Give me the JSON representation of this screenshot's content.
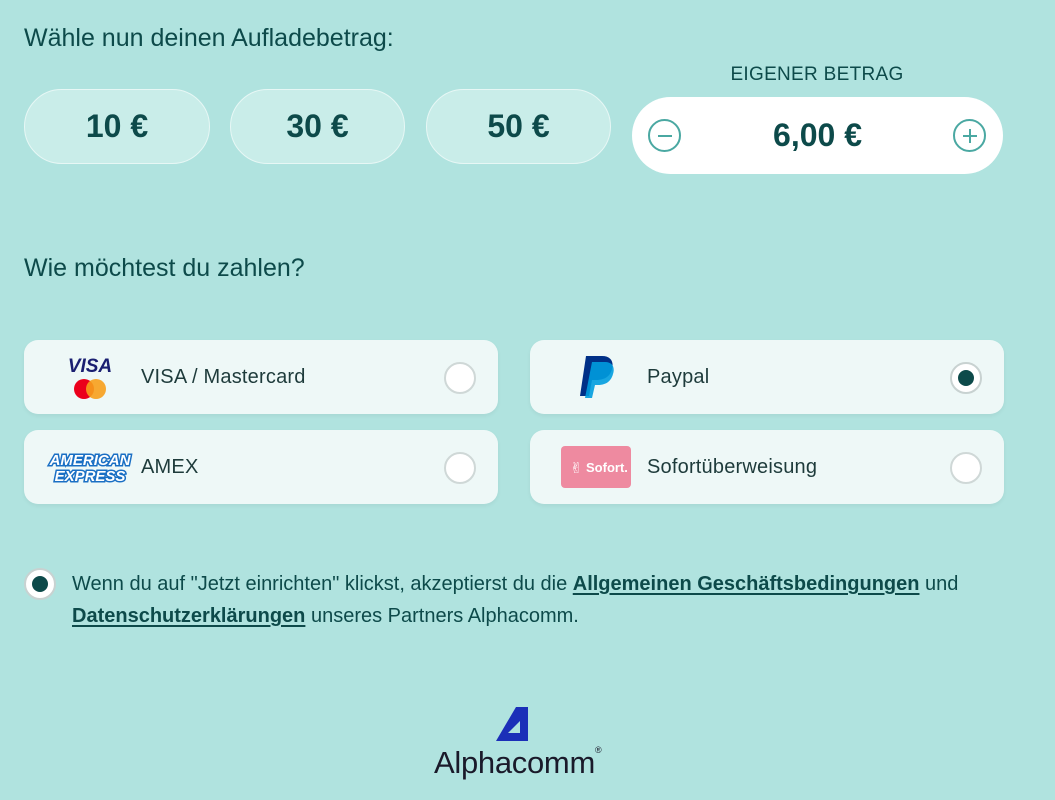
{
  "amount_section": {
    "heading": "Wähle nun deinen Aufladebetrag:",
    "presets": [
      "10 €",
      "30 €",
      "50 €"
    ],
    "custom_label": "EIGENER BETRAG",
    "custom_value": "6,00 €"
  },
  "payment_section": {
    "heading": "Wie möchtest du zahlen?",
    "methods": [
      {
        "label": "VISA / Mastercard",
        "icon": "visa-mastercard-logo",
        "selected": false
      },
      {
        "label": "Paypal",
        "icon": "paypal-logo",
        "selected": true
      },
      {
        "label": "AMEX",
        "icon": "amex-logo",
        "selected": false
      },
      {
        "label": "Sofortüberweisung",
        "icon": "sofort-logo",
        "selected": false
      }
    ],
    "logo_text": {
      "visa": "VISA",
      "amex_line1": "AMERICAN",
      "amex_line2": "EXPRESS",
      "sofort": "Sofort."
    }
  },
  "consent": {
    "checked": true,
    "text_before": "Wenn du auf \"Jetzt einrichten\" klickst, akzeptierst du die ",
    "link_terms": "Allgemeinen Geschäftsbedingungen",
    "text_middle": " und ",
    "link_privacy": "Datenschutzerklärungen",
    "text_after": " unseres Partners Alphacomm."
  },
  "brand": {
    "name": "Alphacomm",
    "reg": "®"
  },
  "colors": {
    "background": "#b0e3df",
    "text": "#0d4a4a",
    "accent": "#4aa8a2",
    "paypal_dark": "#003087",
    "paypal_light": "#009cde",
    "sofort_pink": "#ee8aa0"
  }
}
